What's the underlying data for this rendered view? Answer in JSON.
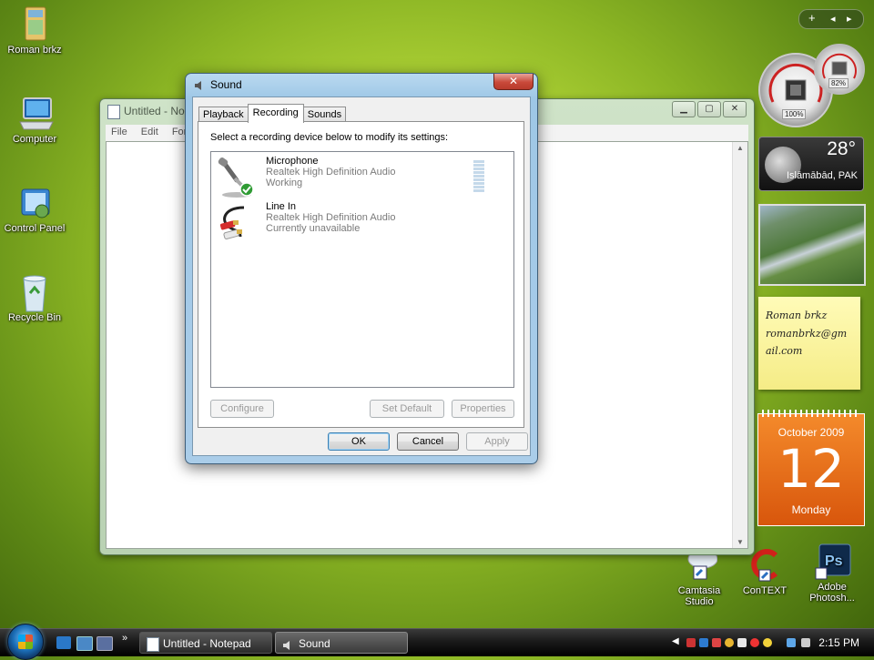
{
  "desktop": {
    "icons": [
      {
        "label": "Roman brkz"
      },
      {
        "label": "Computer"
      },
      {
        "label": "Control Panel"
      },
      {
        "label": "Recycle Bin"
      },
      {
        "label": "Camtasia Studio"
      },
      {
        "label": "ConTEXT"
      },
      {
        "label": "Adobe Photosh..."
      }
    ]
  },
  "notepad": {
    "title": "Untitled - No",
    "menu": [
      "File",
      "Edit",
      "Form"
    ]
  },
  "dialog": {
    "title": "Sound",
    "close_symbol": "✕",
    "tabs": [
      {
        "label": "Playback",
        "active": false
      },
      {
        "label": "Recording",
        "active": true
      },
      {
        "label": "Sounds",
        "active": false
      }
    ],
    "instruction": "Select a recording device below to modify its settings:",
    "devices": [
      {
        "name": "Microphone",
        "driver": "Realtek High Definition Audio",
        "status": "Working",
        "icon": "microphone-icon",
        "default": true
      },
      {
        "name": "Line In",
        "driver": "Realtek High Definition Audio",
        "status": "Currently unavailable",
        "icon": "audio-cable-icon",
        "default": false
      }
    ],
    "buttons": {
      "configure": "Configure",
      "set_default": "Set Default",
      "properties": "Properties",
      "ok": "OK",
      "cancel": "Cancel",
      "apply": "Apply"
    }
  },
  "gadgets": {
    "controls": [
      "+",
      "◂",
      "▸"
    ],
    "cpu_percent": "100%",
    "mem_percent": "82%",
    "weather": {
      "temperature": "28°",
      "location": "Islāmābād, PAK"
    },
    "note_lines": [
      "Roman brkz",
      "romanbrkz@gm",
      "ail.com"
    ],
    "calendar": {
      "month": "October 2009",
      "day": "12",
      "weekday": "Monday"
    }
  },
  "taskbar": {
    "tasks": [
      {
        "label": "Untitled - Notepad",
        "active": false
      },
      {
        "label": "Sound",
        "active": true
      }
    ],
    "chevron": "»",
    "clock": "2:15 PM"
  },
  "colors": {
    "accent": "#3c7fb1",
    "calendar": "#e8701a",
    "desktop": "#9cc22e"
  }
}
